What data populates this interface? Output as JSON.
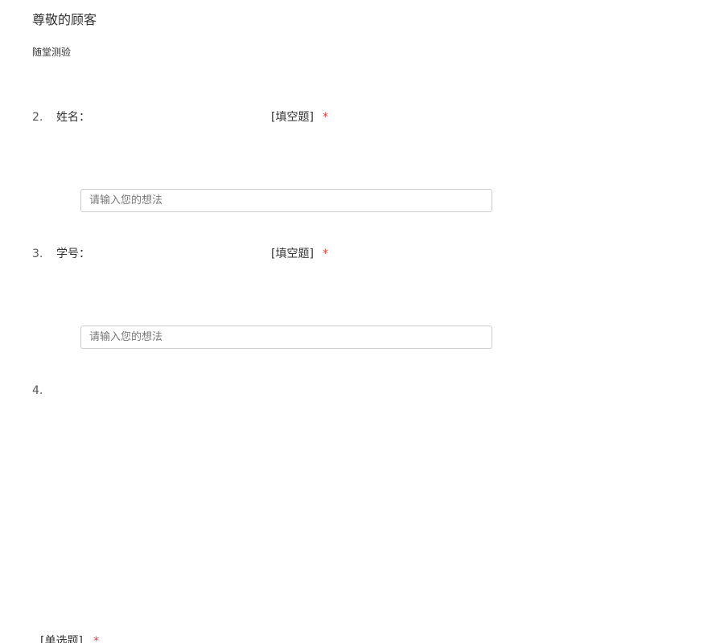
{
  "header": {
    "greeting": "尊敬的顾客",
    "subtitle": "随堂测验"
  },
  "questions": [
    {
      "number": "2.",
      "title": "姓名：",
      "type_label": "[填空题]",
      "required_mark": "*",
      "input_value": "",
      "input_placeholder": "请输入您的想法"
    },
    {
      "number": "3.",
      "title": "学号：",
      "type_label": "[填空题]",
      "required_mark": "*",
      "input_value": "",
      "input_placeholder": "请输入您的想法"
    },
    {
      "number": "4.",
      "title": "",
      "type_label": "[单选题]",
      "required_mark": "*"
    }
  ],
  "colors": {
    "required": "#e64340",
    "input_border": "#cccccc"
  }
}
